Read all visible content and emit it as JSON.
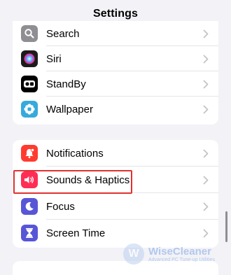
{
  "header": {
    "title": "Settings"
  },
  "group1": [
    {
      "label": "Search",
      "icon": "search-icon",
      "color": "#8e8e93"
    },
    {
      "label": "Siri",
      "icon": "siri-icon",
      "color": "#1c1c1e"
    },
    {
      "label": "StandBy",
      "icon": "standby-icon",
      "color": "#000000"
    },
    {
      "label": "Wallpaper",
      "icon": "wallpaper-icon",
      "color": "#36aadc"
    }
  ],
  "group2": [
    {
      "label": "Notifications",
      "icon": "bell-icon",
      "color": "#ff3b30"
    },
    {
      "label": "Sounds & Haptics",
      "icon": "speaker-icon",
      "color": "#ff2d55"
    },
    {
      "label": "Focus",
      "icon": "moon-icon",
      "color": "#5856d6"
    },
    {
      "label": "Screen Time",
      "icon": "hourglass-icon",
      "color": "#5856d6"
    }
  ],
  "highlight_color": "#e03131",
  "watermark": {
    "name": "WiseCleaner",
    "tagline": "Advanced PC Tune-up Utilities",
    "logo_letter": "W"
  }
}
